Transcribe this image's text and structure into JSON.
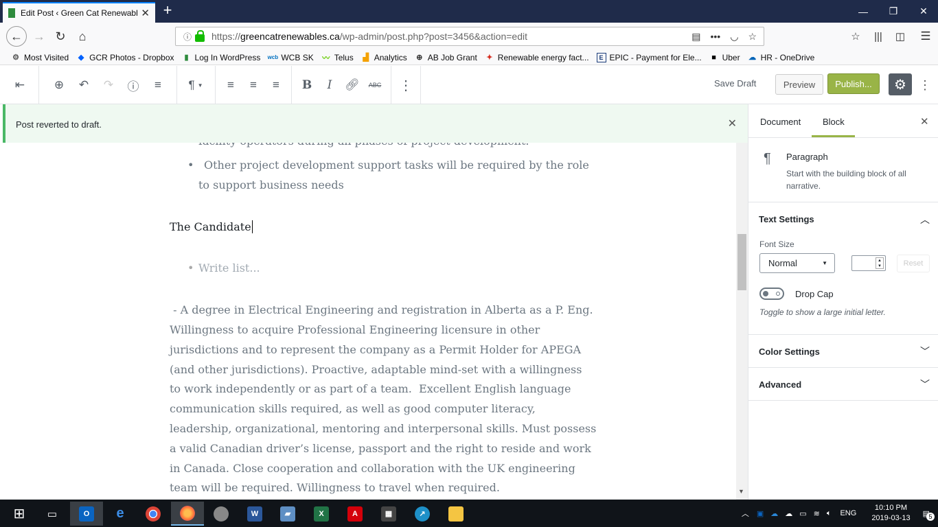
{
  "browser": {
    "tab_title": "Edit Post ‹ Green Cat Renewables",
    "url_prefix": "https://",
    "url_domain": "greencatrenewables.ca",
    "url_path": "/wp-admin/post.php?post=3456&action=edit"
  },
  "bookmarks": [
    {
      "label": "Most Visited",
      "icon": "gear-icon"
    },
    {
      "label": "GCR Photos - Dropbox",
      "icon": "dropbox-icon"
    },
    {
      "label": "Log In WordPress",
      "icon": "bookmark-icon"
    },
    {
      "label": "WCB SK",
      "icon": "wcb-icon"
    },
    {
      "label": "Telus",
      "icon": "telus-icon"
    },
    {
      "label": "Analytics",
      "icon": "analytics-icon"
    },
    {
      "label": "AB Job Grant",
      "icon": "globe-icon"
    },
    {
      "label": "Renewable energy fact...",
      "icon": "maple-leaf-icon"
    },
    {
      "label": "EPIC - Payment for Ele...",
      "icon": "epic-icon"
    },
    {
      "label": "Uber",
      "icon": "uber-icon"
    },
    {
      "label": "HR - OneDrive",
      "icon": "onedrive-icon"
    }
  ],
  "toolbar": {
    "save_draft": "Save Draft",
    "preview": "Preview",
    "publish": "Publish..."
  },
  "notice": {
    "text": "Post reverted to draft."
  },
  "editor": {
    "partial_line": "facility operators during all phases of project development.",
    "list_item_line1": "Other project development support tasks will be required by the role",
    "list_item_line2": "to support business needs",
    "heading": "The Candidate",
    "list_placeholder": "Write list...",
    "body_lines": [
      " - A degree in Electrical Engineering and registration in Alberta as a P. Eng.",
      "Willingness to acquire Professional Engineering licensure in other",
      "jurisdictions and to represent the company as a Permit Holder for APEGA",
      "(and other jurisdictions). Proactive, adaptable mind-set with a willingness",
      "to work independently or as part of a team.  Excellent English language",
      "communication skills required, as well as good computer literacy,",
      "leadership, organizational, mentoring and interpersonal skills. Must possess",
      "a valid Canadian driver’s license, passport and the right to reside and work",
      "in Canada. Close cooperation and collaboration with the UK engineering",
      "team will be required. Willingness to travel when required."
    ]
  },
  "sidebar": {
    "tab_document": "Document",
    "tab_block": "Block",
    "block_name": "Paragraph",
    "block_desc_line1": "Start with the building block of all",
    "block_desc_line2": "narrative.",
    "text_settings": "Text Settings",
    "font_size_label": "Font Size",
    "font_size_value": "Normal",
    "reset": "Reset",
    "drop_cap": "Drop Cap",
    "drop_cap_help": "Toggle to show a large initial letter.",
    "color_settings": "Color Settings",
    "advanced": "Advanced"
  },
  "taskbar": {
    "language": "ENG",
    "time": "10:10 PM",
    "date": "2019-03-13",
    "notifications": "5"
  },
  "colors": {
    "publish": "#99b447",
    "notice_border": "#4ab866",
    "titlebar": "#1f2b4a"
  }
}
